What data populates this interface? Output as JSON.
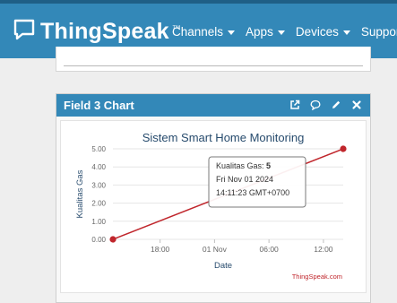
{
  "app": {
    "brand": "ThingSpeak",
    "brand_tm": "™",
    "logo_icon": "chat-bubble-icon",
    "colors": {
      "header": "#3388b8",
      "series": "#c0262c",
      "title": "#274b6d"
    }
  },
  "nav": {
    "items": [
      {
        "label": "Channels",
        "icon": "chevron-down-icon"
      },
      {
        "label": "Apps",
        "icon": "chevron-down-icon"
      },
      {
        "label": "Devices",
        "icon": "chevron-down-icon"
      },
      {
        "label": "Support",
        "icon": "chevron-down-icon"
      }
    ]
  },
  "panel": {
    "title": "Field 3 Chart",
    "tools": [
      "external-link-icon",
      "comment-icon",
      "pencil-icon",
      "close-icon"
    ]
  },
  "chart_data": {
    "type": "line",
    "title": "Sistem Smart Home Monitoring",
    "xlabel": "Date",
    "ylabel": "Kualitas Gas",
    "ylim": [
      0,
      5
    ],
    "yticks": [
      "0.00",
      "1.00",
      "2.00",
      "3.00",
      "4.00",
      "5.00"
    ],
    "xticks": [
      "18:00",
      "01 Nov",
      "06:00",
      "12:00"
    ],
    "series": [
      {
        "x": [
          "2024-10-31 12:48",
          "2024-11-01 14:11"
        ],
        "values": [
          0,
          5
        ]
      }
    ],
    "tooltip": {
      "line1_label": "Kualitas Gas:",
      "line1_value": "5",
      "line2": "Fri Nov 01 2024",
      "line3": "14:11:23 GMT+0700"
    },
    "credit": "ThingSpeak.com"
  }
}
